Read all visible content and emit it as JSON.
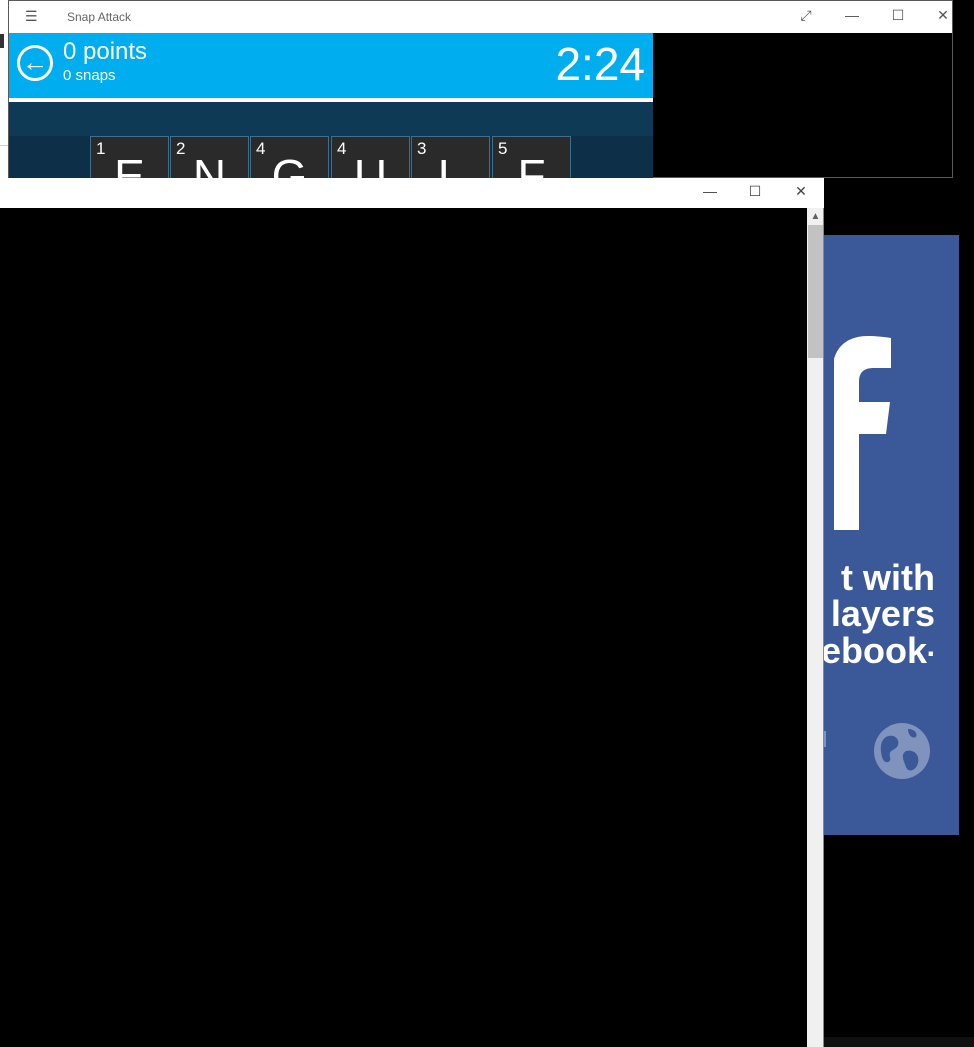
{
  "snap_window": {
    "title": "Snap Attack",
    "menu_glyph": "☰",
    "controls": {
      "expand": "⤢",
      "minimize": "—",
      "maximize": "☐",
      "close": "✕"
    }
  },
  "game": {
    "points_label": "0 points",
    "snaps_label": "0 snaps",
    "timer": "2:24",
    "back_icon": "←",
    "tiles": [
      {
        "num": "1",
        "letter": "E"
      },
      {
        "num": "2",
        "letter": "N"
      },
      {
        "num": "4",
        "letter": "G"
      },
      {
        "num": "4",
        "letter": "U"
      },
      {
        "num": "3",
        "letter": "L"
      },
      {
        "num": "5",
        "letter": "F"
      }
    ]
  },
  "facebook_panel": {
    "line1": "t with",
    "line2": "layers",
    "line3": "ebook",
    "line3_dot": ".",
    "brand_color": "#3b5998",
    "icons": [
      "like-icon",
      "globe-icon"
    ]
  },
  "front_window": {
    "controls": {
      "minimize": "—",
      "maximize": "☐",
      "close": "✕"
    },
    "scroll_up": "▲"
  },
  "colors": {
    "header_blue": "#00adef",
    "facebook_blue": "#3b5998"
  }
}
